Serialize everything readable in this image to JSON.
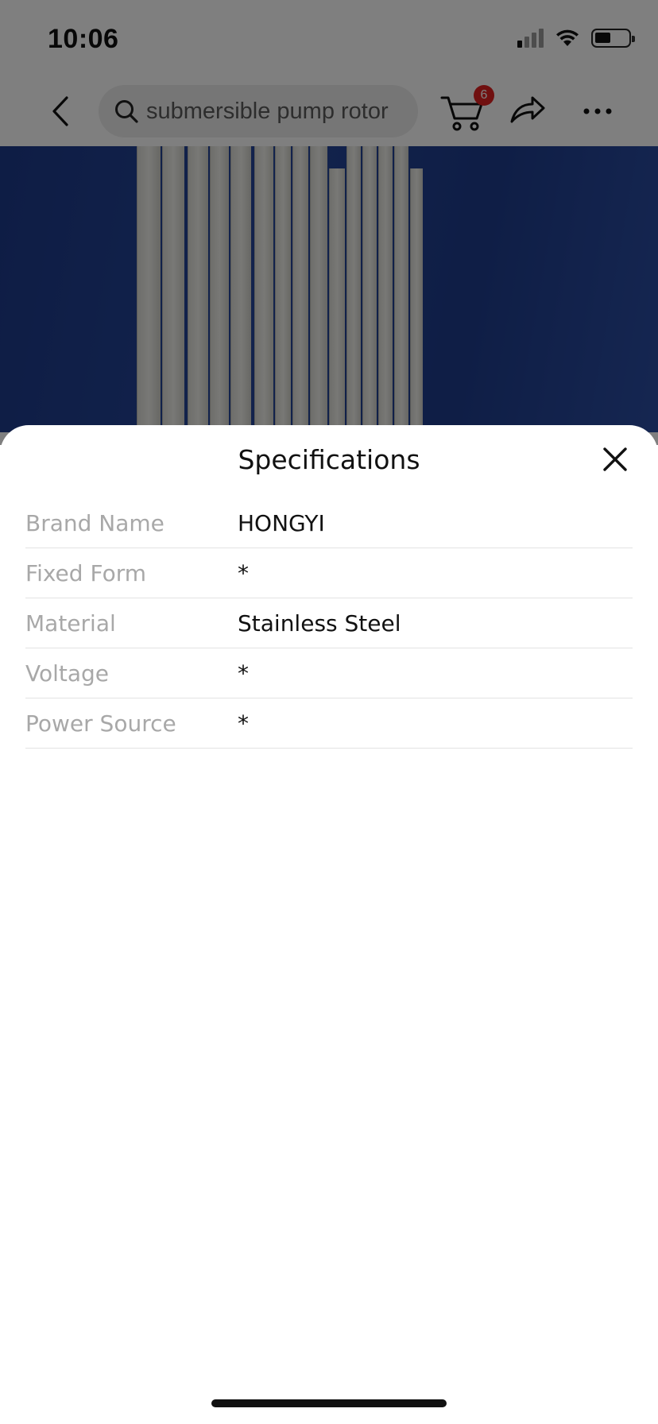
{
  "status_bar": {
    "time": "10:06"
  },
  "nav": {
    "search_text": "submersible pump rotor",
    "cart_count": "6"
  },
  "sheet": {
    "title": "Specifications",
    "specs": [
      {
        "label": "Brand Name",
        "value": "HONGYI"
      },
      {
        "label": "Fixed Form",
        "value": "*"
      },
      {
        "label": "Material",
        "value": "Stainless Steel"
      },
      {
        "label": "Voltage",
        "value": "*"
      },
      {
        "label": "Power Source",
        "value": "*"
      }
    ]
  },
  "colors": {
    "badge": "#e02020",
    "label_gray": "#a8a8a8",
    "image_blue": "#25469a"
  },
  "icons": [
    "signal-icon",
    "wifi-icon",
    "battery-icon",
    "back-icon",
    "search-icon",
    "cart-icon",
    "share-icon",
    "more-icon",
    "close-icon"
  ]
}
